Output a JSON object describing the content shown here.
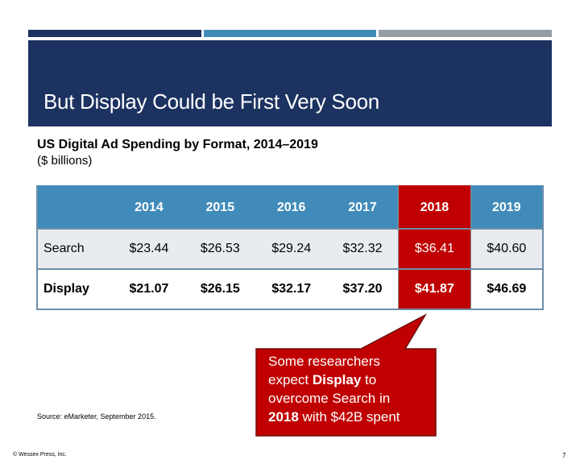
{
  "slide": {
    "title": "But Display Could be First Very Soon",
    "subtitle": "US Digital Ad Spending by Format, 2014–2019",
    "units": "($ billions)",
    "source": "Source: eMarketer, September 2015.",
    "copyright": "© Wessex Press, Inc.",
    "page_number": "7"
  },
  "colors": {
    "navy": "#1C3260",
    "blue": "#418BBA",
    "gray": "#959CA3",
    "highlight_red": "#C00000",
    "row_alt": "#E8ECF1"
  },
  "table": {
    "headers": [
      "",
      "2014",
      "2015",
      "2016",
      "2017",
      "2018",
      "2019"
    ],
    "highlight_column": "2018",
    "rows": [
      {
        "label": "Search",
        "values": [
          "$23.44",
          "$26.53",
          "$29.24",
          "$32.32",
          "$36.41",
          "$40.60"
        ]
      },
      {
        "label": "Display",
        "values": [
          "$21.07",
          "$26.15",
          "$32.17",
          "$37.20",
          "$41.87",
          "$46.69"
        ]
      }
    ]
  },
  "callout": {
    "line1": "Some researchers",
    "line2_pre": "expect ",
    "line2_bold": "Display",
    "line2_post": " to",
    "line3": "overcome Search in",
    "line4_bold": "2018",
    "line4_post": " with $42B spent"
  }
}
